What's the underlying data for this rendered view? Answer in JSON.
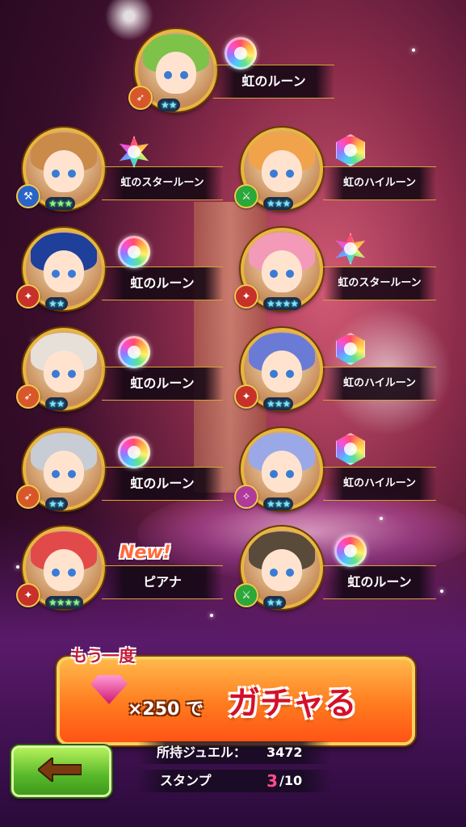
{
  "results": [
    {
      "id": "r1",
      "reward": "虹のルーン",
      "rune": "rune",
      "stars": "★★",
      "class": "bow",
      "classColor": "#d8572a",
      "hair": "#7ec24a"
    },
    {
      "id": "r2",
      "reward": "虹のスタールーン",
      "rune": "star",
      "stars": "★★★",
      "class": "axe",
      "classColor": "#2a64c8",
      "hair": "#c98a4a"
    },
    {
      "id": "r3",
      "reward": "虹のハイルーン",
      "rune": "hi",
      "stars": "★★★",
      "class": "blade",
      "classColor": "#2aa83a",
      "hair": "#f0a34a"
    },
    {
      "id": "r4",
      "reward": "虹のルーン",
      "rune": "rune",
      "stars": "★★",
      "class": "dagger",
      "classColor": "#c8302a",
      "hair": "#1e3f9a"
    },
    {
      "id": "r5",
      "reward": "虹のスタールーン",
      "rune": "star",
      "stars": "★★★★",
      "class": "dagger",
      "classColor": "#c8302a",
      "hair": "#f29ab8"
    },
    {
      "id": "r6",
      "reward": "虹のルーン",
      "rune": "rune",
      "stars": "★★",
      "class": "bow",
      "classColor": "#d8572a",
      "hair": "#e6e0d8"
    },
    {
      "id": "r7",
      "reward": "虹のハイルーン",
      "rune": "hi",
      "stars": "★★★",
      "class": "dagger",
      "classColor": "#c8302a",
      "hair": "#6a7bd6"
    },
    {
      "id": "r8",
      "reward": "虹のルーン",
      "rune": "rune",
      "stars": "★★",
      "class": "bow",
      "classColor": "#d8572a",
      "hair": "#c8ccd4"
    },
    {
      "id": "r9",
      "reward": "虹のハイルーン",
      "rune": "hi",
      "stars": "★★★",
      "class": "wand",
      "classColor": "#b03a9a",
      "hair": "#9aa8e8"
    },
    {
      "id": "r10",
      "reward": "ピアナ",
      "rune": "none",
      "stars": "★★★★",
      "class": "dagger",
      "classColor": "#c8302a",
      "hair": "#e24a4a",
      "new": "New!"
    },
    {
      "id": "r11",
      "reward": "虹のルーン",
      "rune": "rune",
      "stars": "★★",
      "class": "blade",
      "classColor": "#2aa83a",
      "hair": "#5a4a3a"
    }
  ],
  "again": {
    "title": "もう一度",
    "cost": "×250 で",
    "action": "ガチャる"
  },
  "jewels": {
    "label": "所持ジュエル：",
    "value": "3472"
  },
  "stamp": {
    "label": "スタンプ",
    "current": "3",
    "total": "/10"
  },
  "back": {
    "icon": "back-arrow-icon"
  },
  "colors": {
    "gold": "#e8b640",
    "againOrange": "#ff7a1e",
    "backGreen": "#57b82a",
    "gachaRed": "#d4102a"
  }
}
